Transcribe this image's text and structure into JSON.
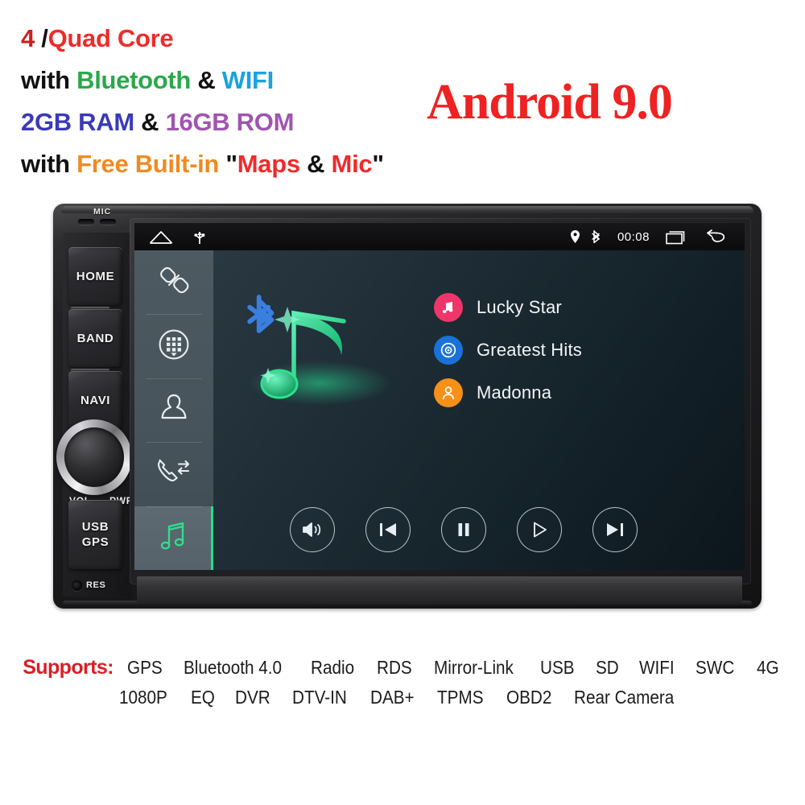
{
  "promo": {
    "lines": [
      {
        "id": "cores",
        "parts": [
          {
            "text": "4 ",
            "color": "#cc2020"
          },
          {
            "text": "/",
            "color": "#111111"
          },
          {
            "text": "Quad Core",
            "color": "#ee2b2b"
          }
        ]
      },
      {
        "id": "wireless",
        "parts": [
          {
            "text": "with ",
            "color": "#111111"
          },
          {
            "text": "Bluetooth",
            "color": "#2aa84a"
          },
          {
            "text": " & ",
            "color": "#111111"
          },
          {
            "text": "WIFI",
            "color": "#1aa3dd"
          }
        ]
      },
      {
        "id": "memory",
        "parts": [
          {
            "text": "2GB RAM",
            "color": "#3a3ab8"
          },
          {
            "text": " & ",
            "color": "#111111"
          },
          {
            "text": "16GB ROM",
            "color": "#a054b0"
          }
        ]
      },
      {
        "id": "builtin",
        "parts": [
          {
            "text": "with ",
            "color": "#111111"
          },
          {
            "text": "Free Built-in ",
            "color": "#f08a22"
          },
          {
            "text": "\"",
            "color": "#111111"
          },
          {
            "text": "Maps",
            "color": "#ee2b2b"
          },
          {
            "text": " & ",
            "color": "#111111"
          },
          {
            "text": "Mic",
            "color": "#ee2b2b"
          },
          {
            "text": "\"",
            "color": "#111111"
          }
        ]
      }
    ],
    "android_badge": "Android 9.0",
    "android_badge_color": "#ee2222"
  },
  "device": {
    "mic_label": "MIC",
    "buttons": [
      {
        "name": "home",
        "label": "HOME"
      },
      {
        "name": "band",
        "label": "BAND"
      },
      {
        "name": "navi",
        "label": "NAVI"
      }
    ],
    "usb_gps": {
      "line1": "USB",
      "line2": "GPS"
    },
    "knob": {
      "left_label": "VOL",
      "right_label": "PWR"
    },
    "reset_label": "RES"
  },
  "screen": {
    "statusbar": {
      "left_icons": [
        "home-icon",
        "usb-icon"
      ],
      "right_icons": [
        "location-pin-icon",
        "bluetooth-icon"
      ],
      "clock": "00:08",
      "trailing_icons": [
        "recent-apps-icon",
        "back-arrow-icon"
      ]
    },
    "sidebar": {
      "items": [
        {
          "name": "bluetooth-pair",
          "icon": "broken-link-icon",
          "active": false
        },
        {
          "name": "dialpad",
          "icon": "dialpad-circle-icon",
          "active": false
        },
        {
          "name": "contacts",
          "icon": "person-icon",
          "active": false
        },
        {
          "name": "call-history",
          "icon": "call-transfer-icon",
          "active": false
        },
        {
          "name": "music",
          "icon": "music-note-icon",
          "active": true
        }
      ],
      "active_accent": "#24e08a"
    },
    "artwork": {
      "note_icon": "music-note-icon",
      "note_color": "#2ee08f",
      "bluetooth_icon": "bluetooth-icon",
      "bluetooth_color": "#3a7fe0"
    },
    "tracks": [
      {
        "label": "Lucky Star",
        "icon": "music-note-icon",
        "color": "#f0356b"
      },
      {
        "label": "Greatest Hits",
        "icon": "disc-icon",
        "color": "#1a72d8"
      },
      {
        "label": "Madonna",
        "icon": "person-icon",
        "color": "#f59018"
      }
    ],
    "controls": [
      {
        "name": "volume-button",
        "icon": "speaker-icon"
      },
      {
        "name": "previous-button",
        "icon": "previous-track-icon"
      },
      {
        "name": "pause-button",
        "icon": "pause-icon"
      },
      {
        "name": "play-button",
        "icon": "play-icon"
      },
      {
        "name": "next-button",
        "icon": "next-track-icon"
      }
    ]
  },
  "supports": {
    "label": "Supports:",
    "label_color": "#d81f26",
    "row1": [
      "GPS",
      "Bluetooth 4.0",
      "Radio",
      "RDS",
      "Mirror-Link",
      "USB",
      "SD",
      "WIFI",
      "SWC",
      "4G"
    ],
    "row2": [
      "1080P",
      "EQ",
      "DVR",
      "DTV-IN",
      "DAB+",
      "TPMS",
      "OBD2",
      "Rear Camera"
    ]
  }
}
